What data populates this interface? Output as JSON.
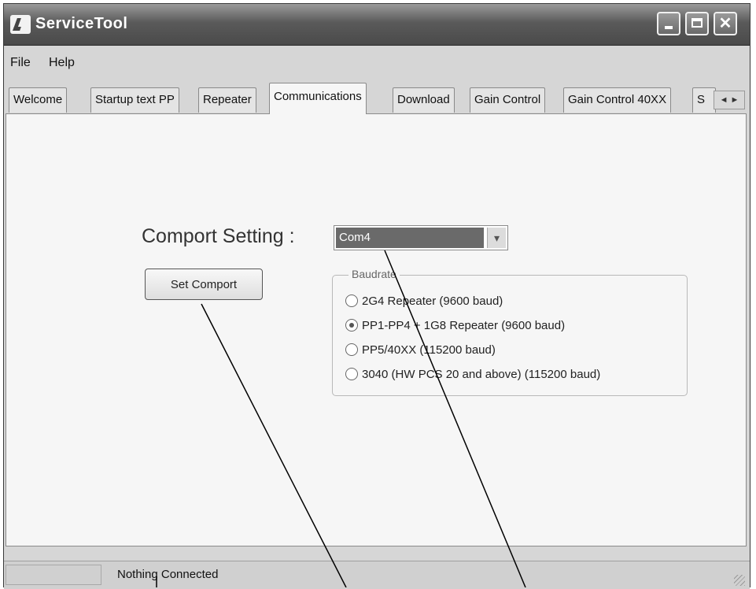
{
  "window": {
    "title": "ServiceTool"
  },
  "menu": {
    "items": [
      "File",
      "Help"
    ]
  },
  "tabs": {
    "items": [
      "Welcome",
      "Startup text PP",
      "Repeater",
      "Communications",
      "Download",
      "Gain Control",
      "Gain Control 40XX",
      "S"
    ],
    "active": "Communications",
    "scroll_arrows": "◄ ►"
  },
  "communications": {
    "comport_label": "Comport Setting :",
    "comport_value": "Com4",
    "set_button_label": "Set Comport",
    "baudrate": {
      "legend": "Baudrate",
      "options": [
        {
          "label": "2G4 Repeater (9600 baud)",
          "selected": false
        },
        {
          "label": "PP1-PP4 + 1G8 Repeater (9600 baud)",
          "selected": true
        },
        {
          "label": "PP5/40XX (115200 baud)",
          "selected": false
        },
        {
          "label": "3040 (HW PCS 20 and above) (115200 baud)",
          "selected": false
        }
      ]
    }
  },
  "statusbar": {
    "status_text": "Nothing Connected"
  }
}
